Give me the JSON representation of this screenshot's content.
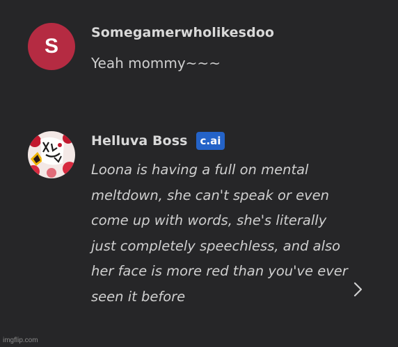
{
  "messages": [
    {
      "author": "Somegamerwholikesdoo",
      "avatar_letter": "S",
      "avatar_color": "#b52b42",
      "text": "Yeah mommy~~~"
    },
    {
      "author": "Helluva Boss",
      "badge": "c.ai",
      "badge_color": "#2463c8",
      "avatar_logo_text": "Helluva Boss",
      "text": "Loona is having a full on mental meltdown, she can't speak or even come up with words, she's literally just completely speechless, and also her face is more red than you've ever seen it before"
    }
  ],
  "next_icon": "chevron-right-icon",
  "watermark": "imgflip.com"
}
